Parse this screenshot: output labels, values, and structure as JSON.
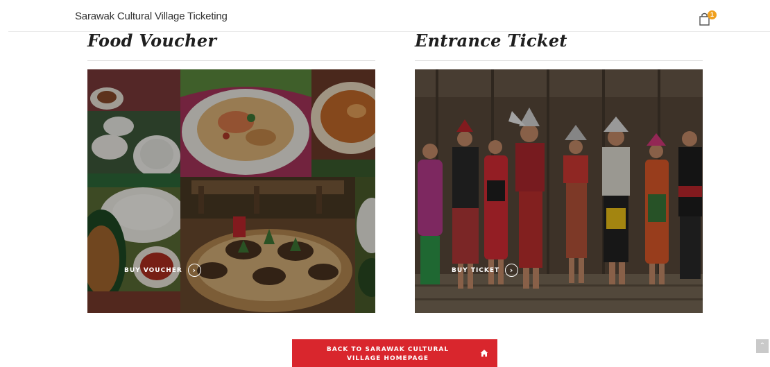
{
  "header": {
    "brand": "Sarawak Cultural Village Ticketing",
    "cart_icon": "shopping-bag-icon",
    "cart_count": "1",
    "badge_color": "#f0a01e"
  },
  "cards": [
    {
      "title": "Food Voucher",
      "cta_label": "BUY VOUCHER",
      "cta_icon": "chevron-right-circle-icon"
    },
    {
      "title": "Entrance Ticket",
      "cta_label": "BUY TICKET",
      "cta_icon": "chevron-right-circle-icon"
    }
  ],
  "footer": {
    "back_label": "BACK TO SARAWAK CULTURAL VILLAGE HOMEPAGE",
    "back_icon": "home-icon",
    "button_color": "#d9262d",
    "scroll_top_icon": "chevron-up-icon"
  }
}
